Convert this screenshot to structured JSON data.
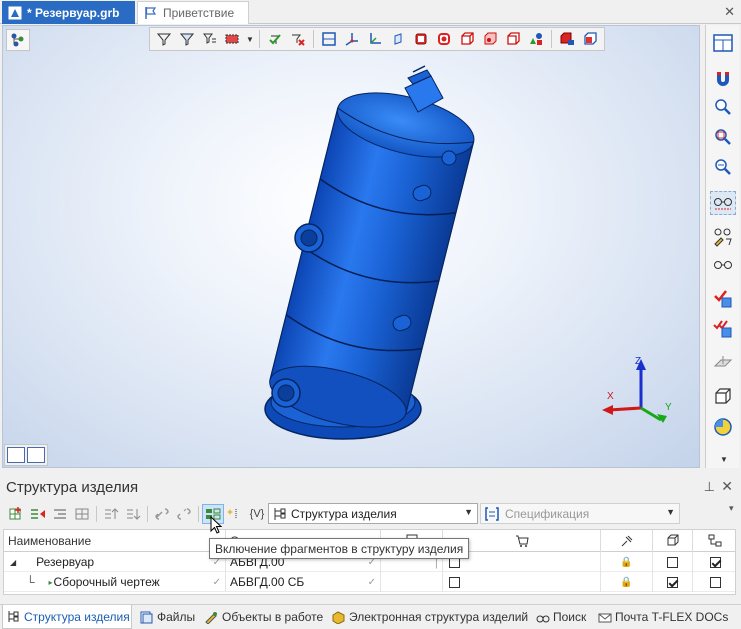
{
  "tabs": [
    {
      "label": "* Резервуар.grb",
      "active": true
    },
    {
      "label": "Приветствие",
      "active": false
    }
  ],
  "viewport": {
    "axes": {
      "x": "X",
      "y": "Y",
      "z": "Z"
    }
  },
  "viewport_toolbar_icons": [
    "filter-icon",
    "filter-select-icon",
    "filter-list-icon",
    "select-box-icon",
    "dropdown-arrow-icon",
    "check-icon",
    "uncheck-icon",
    "view-front-icon",
    "view-axis-icon",
    "view-axis2-icon",
    "view-iso-icon",
    "solid-red-icon",
    "cube-red-icon",
    "cube-outline-icon",
    "cube-shaded-icon",
    "cube-hidden-icon",
    "shapes-icon",
    "cube-render-icon",
    "cube-color-icon"
  ],
  "right_toolbar_icons": [
    "window-layout-icon",
    "magnet-icon",
    "zoom-in-icon",
    "zoom-window-icon",
    "zoom-out-icon",
    "glasses-dashed-icon",
    "glasses-edit-icon",
    "glasses-icon",
    "check-cube-icon",
    "double-check-cube-icon",
    "plane-icon",
    "cube-wire-icon",
    "sphere-yellow-icon"
  ],
  "panel": {
    "title": "Структура изделия",
    "pin": "📌",
    "close": "✕",
    "combo_structure": "Структура изделия",
    "combo_spec": "Спецификация",
    "tooltip": "Включение фрагментов в структуру изделия",
    "columns": {
      "name": "Наименование",
      "designation": "О...",
      "c3": "",
      "c4": "",
      "c5": "",
      "c6": "",
      "c7": ""
    },
    "rows": [
      {
        "expander": "◢",
        "name": "Резервуар",
        "designation": "АБВГД.00",
        "lock": "🔒",
        "c6": false,
        "c7": true
      },
      {
        "expander": "└",
        "name": "Сборочный чертеж",
        "designation": "АБВГД.00 СБ",
        "lock": "🔒",
        "c6": true,
        "c7": false
      }
    ]
  },
  "bottom_tabs": [
    {
      "label": "Структура изделия",
      "active": true
    },
    {
      "label": "Файлы",
      "active": false
    },
    {
      "label": "Объекты в работе",
      "active": false
    },
    {
      "label": "Электронная структура изделий",
      "active": false
    },
    {
      "label": "Поиск",
      "active": false
    },
    {
      "label": "Почта T-FLEX DOCs",
      "active": false
    }
  ],
  "colors": {
    "accent": "#2a6cc4",
    "model": "#1a63d6",
    "model_dark": "#0b3f9c"
  }
}
